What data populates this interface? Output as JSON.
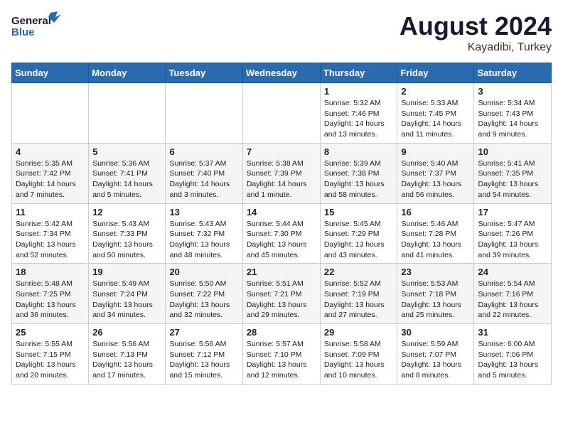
{
  "header": {
    "logo_general": "General",
    "logo_blue": "Blue",
    "month_title": "August 2024",
    "location": "Kayadibi, Turkey"
  },
  "days_of_week": [
    "Sunday",
    "Monday",
    "Tuesday",
    "Wednesday",
    "Thursday",
    "Friday",
    "Saturday"
  ],
  "weeks": [
    [
      {
        "day": "",
        "info": ""
      },
      {
        "day": "",
        "info": ""
      },
      {
        "day": "",
        "info": ""
      },
      {
        "day": "",
        "info": ""
      },
      {
        "day": "1",
        "info": "Sunrise: 5:32 AM\nSunset: 7:46 PM\nDaylight: 14 hours\nand 13 minutes."
      },
      {
        "day": "2",
        "info": "Sunrise: 5:33 AM\nSunset: 7:45 PM\nDaylight: 14 hours\nand 11 minutes."
      },
      {
        "day": "3",
        "info": "Sunrise: 5:34 AM\nSunset: 7:43 PM\nDaylight: 14 hours\nand 9 minutes."
      }
    ],
    [
      {
        "day": "4",
        "info": "Sunrise: 5:35 AM\nSunset: 7:42 PM\nDaylight: 14 hours\nand 7 minutes."
      },
      {
        "day": "5",
        "info": "Sunrise: 5:36 AM\nSunset: 7:41 PM\nDaylight: 14 hours\nand 5 minutes."
      },
      {
        "day": "6",
        "info": "Sunrise: 5:37 AM\nSunset: 7:40 PM\nDaylight: 14 hours\nand 3 minutes."
      },
      {
        "day": "7",
        "info": "Sunrise: 5:38 AM\nSunset: 7:39 PM\nDaylight: 14 hours\nand 1 minute."
      },
      {
        "day": "8",
        "info": "Sunrise: 5:39 AM\nSunset: 7:38 PM\nDaylight: 13 hours\nand 58 minutes."
      },
      {
        "day": "9",
        "info": "Sunrise: 5:40 AM\nSunset: 7:37 PM\nDaylight: 13 hours\nand 56 minutes."
      },
      {
        "day": "10",
        "info": "Sunrise: 5:41 AM\nSunset: 7:35 PM\nDaylight: 13 hours\nand 54 minutes."
      }
    ],
    [
      {
        "day": "11",
        "info": "Sunrise: 5:42 AM\nSunset: 7:34 PM\nDaylight: 13 hours\nand 52 minutes."
      },
      {
        "day": "12",
        "info": "Sunrise: 5:43 AM\nSunset: 7:33 PM\nDaylight: 13 hours\nand 50 minutes."
      },
      {
        "day": "13",
        "info": "Sunrise: 5:43 AM\nSunset: 7:32 PM\nDaylight: 13 hours\nand 48 minutes."
      },
      {
        "day": "14",
        "info": "Sunrise: 5:44 AM\nSunset: 7:30 PM\nDaylight: 13 hours\nand 45 minutes."
      },
      {
        "day": "15",
        "info": "Sunrise: 5:45 AM\nSunset: 7:29 PM\nDaylight: 13 hours\nand 43 minutes."
      },
      {
        "day": "16",
        "info": "Sunrise: 5:46 AM\nSunset: 7:28 PM\nDaylight: 13 hours\nand 41 minutes."
      },
      {
        "day": "17",
        "info": "Sunrise: 5:47 AM\nSunset: 7:26 PM\nDaylight: 13 hours\nand 39 minutes."
      }
    ],
    [
      {
        "day": "18",
        "info": "Sunrise: 5:48 AM\nSunset: 7:25 PM\nDaylight: 13 hours\nand 36 minutes."
      },
      {
        "day": "19",
        "info": "Sunrise: 5:49 AM\nSunset: 7:24 PM\nDaylight: 13 hours\nand 34 minutes."
      },
      {
        "day": "20",
        "info": "Sunrise: 5:50 AM\nSunset: 7:22 PM\nDaylight: 13 hours\nand 32 minutes."
      },
      {
        "day": "21",
        "info": "Sunrise: 5:51 AM\nSunset: 7:21 PM\nDaylight: 13 hours\nand 29 minutes."
      },
      {
        "day": "22",
        "info": "Sunrise: 5:52 AM\nSunset: 7:19 PM\nDaylight: 13 hours\nand 27 minutes."
      },
      {
        "day": "23",
        "info": "Sunrise: 5:53 AM\nSunset: 7:18 PM\nDaylight: 13 hours\nand 25 minutes."
      },
      {
        "day": "24",
        "info": "Sunrise: 5:54 AM\nSunset: 7:16 PM\nDaylight: 13 hours\nand 22 minutes."
      }
    ],
    [
      {
        "day": "25",
        "info": "Sunrise: 5:55 AM\nSunset: 7:15 PM\nDaylight: 13 hours\nand 20 minutes."
      },
      {
        "day": "26",
        "info": "Sunrise: 5:56 AM\nSunset: 7:13 PM\nDaylight: 13 hours\nand 17 minutes."
      },
      {
        "day": "27",
        "info": "Sunrise: 5:56 AM\nSunset: 7:12 PM\nDaylight: 13 hours\nand 15 minutes."
      },
      {
        "day": "28",
        "info": "Sunrise: 5:57 AM\nSunset: 7:10 PM\nDaylight: 13 hours\nand 12 minutes."
      },
      {
        "day": "29",
        "info": "Sunrise: 5:58 AM\nSunset: 7:09 PM\nDaylight: 13 hours\nand 10 minutes."
      },
      {
        "day": "30",
        "info": "Sunrise: 5:59 AM\nSunset: 7:07 PM\nDaylight: 13 hours\nand 8 minutes."
      },
      {
        "day": "31",
        "info": "Sunrise: 6:00 AM\nSunset: 7:06 PM\nDaylight: 13 hours\nand 5 minutes."
      }
    ]
  ]
}
